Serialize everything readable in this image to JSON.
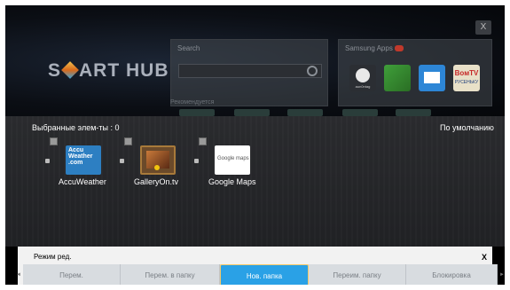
{
  "top": {
    "close_label": "X",
    "logo_part1": "S",
    "logo_part2": "ART HUB",
    "search": {
      "title": "Search"
    },
    "recommend_label": "Рекомендуется",
    "apps": {
      "title": "Samsung Apps",
      "tiles": [
        {
          "label": "aun0ntag"
        },
        {
          "label": ""
        },
        {
          "label": ""
        },
        {
          "label": "ВомТV",
          "sub": "РУСЕНЬКУ"
        }
      ]
    }
  },
  "favorites": {
    "count_label": "Выбранные элем-ты : 0",
    "default_label": "По умолчанию",
    "items": [
      {
        "name": "AccuWeather",
        "icon_line1": "Accu",
        "icon_line2": "Weather",
        "icon_line3": ".com"
      },
      {
        "name": "GalleryOn.tv"
      },
      {
        "name": "Google Maps",
        "icon_text": "Google maps"
      }
    ]
  },
  "edit_bar": {
    "title": "Режим ред.",
    "close_label": "X",
    "left_arrow": "◄",
    "right_arrow": "►",
    "buttons": [
      {
        "label": "Перем."
      },
      {
        "label": "Перем. в папку"
      },
      {
        "label": "Нов. папка"
      },
      {
        "label": "Переим. папку"
      },
      {
        "label": "Блокировка"
      }
    ]
  }
}
